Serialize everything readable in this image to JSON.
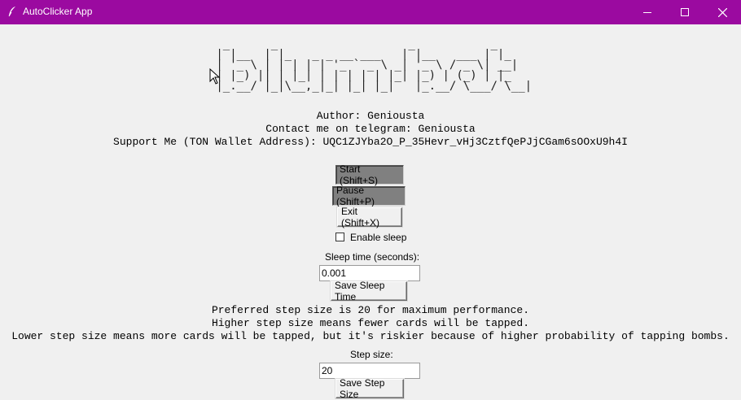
{
  "window": {
    "title": "AutoClicker App",
    "titlebar_color": "#9b0aa0",
    "controls": [
      "minimize-icon",
      "maximize-icon",
      "close-icon"
    ]
  },
  "banner": {
    "ascii_art": "  _      _                   _           _   \n | |__  | |_   _ _ __ ___   | |__   ___ | |_ \n | '_ \\ | | | | | '_ ` _ \\ _| '_ \\ / _ \\| __|\n | |_) || | |_| | | | | | |_| |_) | (_) | |_ \n |_.__/ |_|\\__,_|_| |_| |_|   |_.__/ \\___/ \\__|"
  },
  "info": {
    "author": "Author: Geniousta",
    "contact": "Contact me on telegram: Geniousta",
    "support": "Support Me (TON Wallet Address): UQC1ZJYba2O_P_35Hevr_vHj3CztfQePJjCGam6sOOxU9h4I"
  },
  "buttons": {
    "start": "Start (Shift+S)",
    "pause": "Pause (Shift+P)",
    "exit": "Exit (Shift+X)",
    "save_sleep": "Save Sleep Time",
    "save_step": "Save Step Size"
  },
  "sleep": {
    "checkbox_label": "Enable sleep",
    "checked": false,
    "time_label": "Sleep time (seconds):",
    "time_value": "0.001"
  },
  "step": {
    "note1": "Preferred step size is 20 for maximum performance.",
    "note2": "Higher step size means fewer cards will be tapped.",
    "note3": "Lower step size means more cards will be tapped, but it's riskier because of higher probability of tapping bombs.",
    "label": "Step size:",
    "value": "20"
  }
}
